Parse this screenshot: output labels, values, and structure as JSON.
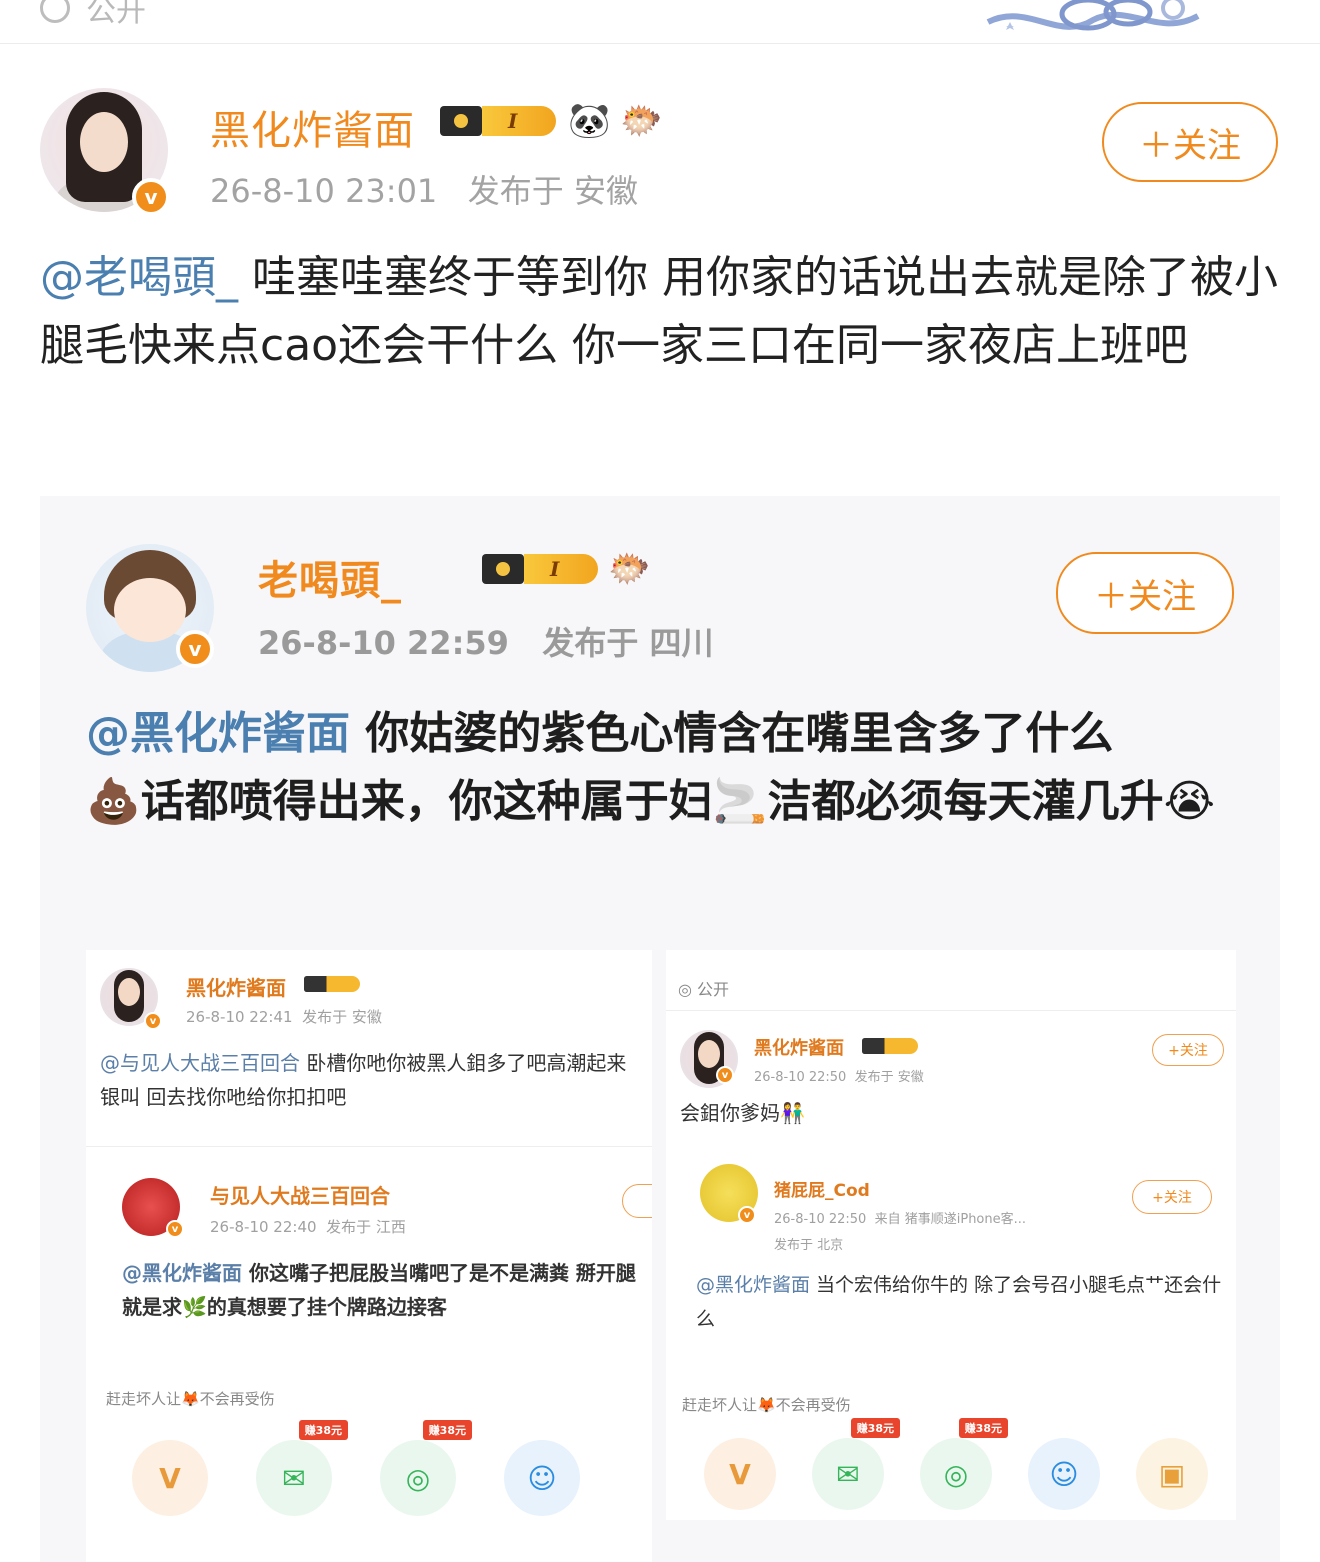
{
  "top": {
    "visibility": "公开"
  },
  "post": {
    "author": "黑化炸酱面",
    "level": "I",
    "badges": [
      "🐼",
      "🐡"
    ],
    "time": "26-8-10 23:01",
    "location": "发布于 安徽",
    "follow_label": "＋关注",
    "mention": "@老喝頭_",
    "text": " 哇塞哇塞终于等到你  用你家的话说出去就是除了被小腿毛快来点cao还会干什么 你一家三口在同一家夜店上班吧"
  },
  "repost": {
    "author": "老喝頭_",
    "level": "I",
    "badge": "🐡",
    "time": "26-8-10 22:59",
    "location": "发布于 四川",
    "follow_label": "＋关注",
    "mention": "@黑化炸酱面",
    "text_1": " 你姑婆的紫色心情含在嘴里含多了什么",
    "emoji_poop": "💩",
    "text_2": "话都喷得出来，你这种属于妇",
    "emoji_cig": "🚬",
    "text_3": "洁都必须每天灌几升",
    "emoji_cry": "😭"
  },
  "shot_left": {
    "author": "黑化炸酱面",
    "time": "26-8-10 22:41",
    "location": "发布于 安徽",
    "mention": "@与见人大战三百回合",
    "text": " 卧槽你吔你被黑人鉬多了吧高潮起来银叫 回去找你吔给你扣扣吧",
    "sub_author": "与见人大战三百回合",
    "sub_time": "26-8-10 22:40",
    "sub_location": "发布于 江西",
    "sub_mention": "@黑化炸酱面",
    "sub_text": " 你这嘴子把屁股当嘴吧了是不是满粪 掰开腿就是求🌿的真想要了挂个牌路边接客",
    "footer": "赶走坏人让🦊不会再受伤",
    "share_tags": [
      "赚38元",
      "赚38元"
    ]
  },
  "shot_right": {
    "visibility": "公开",
    "author": "黑化炸酱面",
    "time": "26-8-10 22:50",
    "location": "发布于 安徽",
    "follow_label": "+关注",
    "text": "会鉬你爹妈👫",
    "sub_author": "猪屁屁_Cod",
    "sub_time": "26-8-10 22:50",
    "sub_source": "来自 猪事顺遂iPhone客...",
    "sub_location": "发布于 北京",
    "sub_follow_label": "+关注",
    "sub_mention": "@黑化炸酱面",
    "sub_text": " 当个宏伟给你牛的 除了会号召小腿毛点艹还会什么",
    "footer": "赶走坏人让🦊不会再受伤",
    "share_tags": [
      "赚38元",
      "赚38元"
    ]
  },
  "colors": {
    "accent": "#f08a1e",
    "mention": "#4a7fb0"
  }
}
